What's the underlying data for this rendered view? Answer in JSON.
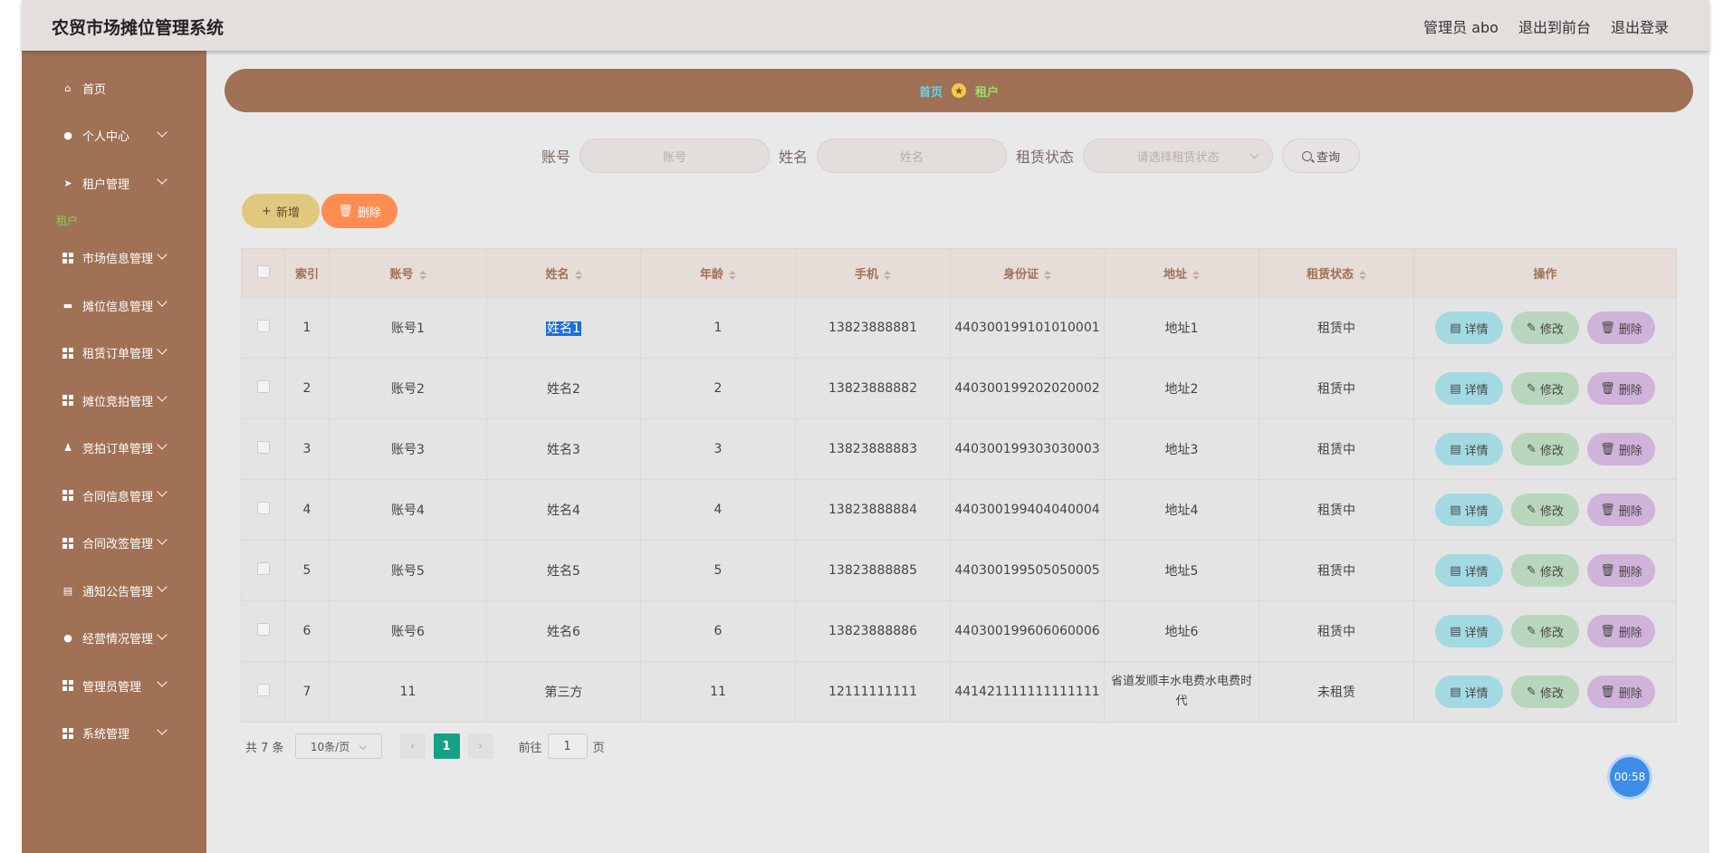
{
  "app_title": "农贸市场摊位管理系统",
  "header": {
    "user": "管理员 abo",
    "to_front": "退出到前台",
    "logout": "退出登录"
  },
  "sidebar": {
    "home": "首页",
    "personal": "个人中心",
    "tenant_mgmt": "租户管理",
    "tenant_sub": "租户",
    "market_info": "市场信息管理",
    "stall_info": "摊位信息管理",
    "rent_order": "租赁订单管理",
    "stall_auction": "摊位竞拍管理",
    "auction_order": "竞拍订单管理",
    "contract_info": "合同信息管理",
    "contract_change": "合同改签管理",
    "notice": "通知公告管理",
    "business": "经营情况管理",
    "admin": "管理员管理",
    "system": "系统管理"
  },
  "breadcrumb": {
    "home": "首页",
    "current": "租户"
  },
  "search": {
    "account_label": "账号",
    "account_placeholder": "账号",
    "name_label": "姓名",
    "name_placeholder": "姓名",
    "status_label": "租赁状态",
    "status_placeholder": "请选择租赁状态",
    "query": "查询"
  },
  "actions": {
    "add": "新增",
    "delete": "删除"
  },
  "table": {
    "headers": {
      "index": "索引",
      "account": "账号",
      "name": "姓名",
      "age": "年龄",
      "phone": "手机",
      "id_card": "身份证",
      "address": "地址",
      "status": "租赁状态",
      "operation": "操作"
    },
    "rows": [
      {
        "index": "1",
        "account": "账号1",
        "name": "姓名1",
        "age": "1",
        "phone": "13823888881",
        "id_card": "440300199101010001",
        "address": "地址1",
        "status": "租赁中"
      },
      {
        "index": "2",
        "account": "账号2",
        "name": "姓名2",
        "age": "2",
        "phone": "13823888882",
        "id_card": "440300199202020002",
        "address": "地址2",
        "status": "租赁中"
      },
      {
        "index": "3",
        "account": "账号3",
        "name": "姓名3",
        "age": "3",
        "phone": "13823888883",
        "id_card": "440300199303030003",
        "address": "地址3",
        "status": "租赁中"
      },
      {
        "index": "4",
        "account": "账号4",
        "name": "姓名4",
        "age": "4",
        "phone": "13823888884",
        "id_card": "440300199404040004",
        "address": "地址4",
        "status": "租赁中"
      },
      {
        "index": "5",
        "account": "账号5",
        "name": "姓名5",
        "age": "5",
        "phone": "13823888885",
        "id_card": "440300199505050005",
        "address": "地址5",
        "status": "租赁中"
      },
      {
        "index": "6",
        "account": "账号6",
        "name": "姓名6",
        "age": "6",
        "phone": "13823888886",
        "id_card": "440300199606060006",
        "address": "地址6",
        "status": "租赁中"
      },
      {
        "index": "7",
        "account": "11",
        "name": "第三方",
        "age": "11",
        "phone": "12111111111",
        "id_card": "441421111111111111",
        "address": "省道发顺丰水电费水电费时代",
        "status": "未租赁"
      }
    ],
    "op_detail": "详情",
    "op_edit": "修改",
    "op_delete": "删除"
  },
  "pagination": {
    "total": "共 7 条",
    "page_size": "10条/页",
    "current_page": "1",
    "goto_prefix": "前往",
    "goto_value": "1",
    "goto_suffix": "页"
  },
  "timer": "00:58",
  "colors": {
    "sidebar_bg": "#a07155",
    "header_bg": "#e4dfdd",
    "add_btn": "#e0c97e",
    "delete_btn": "#ff8c50",
    "detail_btn": "#a3dae1",
    "edit_btn": "#b8d6bb",
    "row_delete_btn": "#cfb3d8",
    "page_active": "#16a085"
  }
}
